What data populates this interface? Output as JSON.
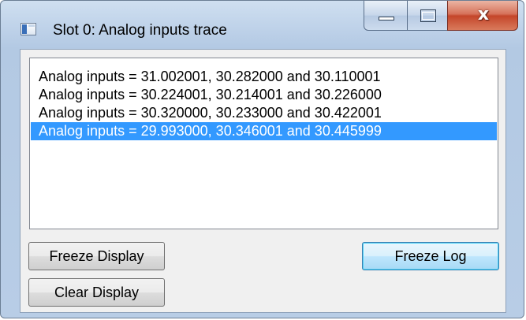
{
  "window": {
    "title": "Slot 0: Analog inputs trace",
    "icon": "app-window-icon",
    "caption_buttons": {
      "minimize_icon": "minimize-icon",
      "maximize_icon": "maximize-icon",
      "close_glyph": "x"
    }
  },
  "trace_list": {
    "items": [
      "Analog inputs = 31.002001, 30.282000 and 30.110001",
      "Analog inputs = 30.224001, 30.214001 and 30.226000",
      "Analog inputs = 30.320000, 30.233000 and 30.422001",
      "Analog inputs = 29.993000, 30.346001 and 30.445999"
    ],
    "selected_index": 3,
    "selection_color": "#3399ff"
  },
  "buttons": {
    "freeze_display": "Freeze Display",
    "clear_display": "Clear Display",
    "freeze_log": "Freeze Log"
  },
  "colors": {
    "close_button": "#c4462a",
    "default_button_accent": "#3c7fb1"
  }
}
